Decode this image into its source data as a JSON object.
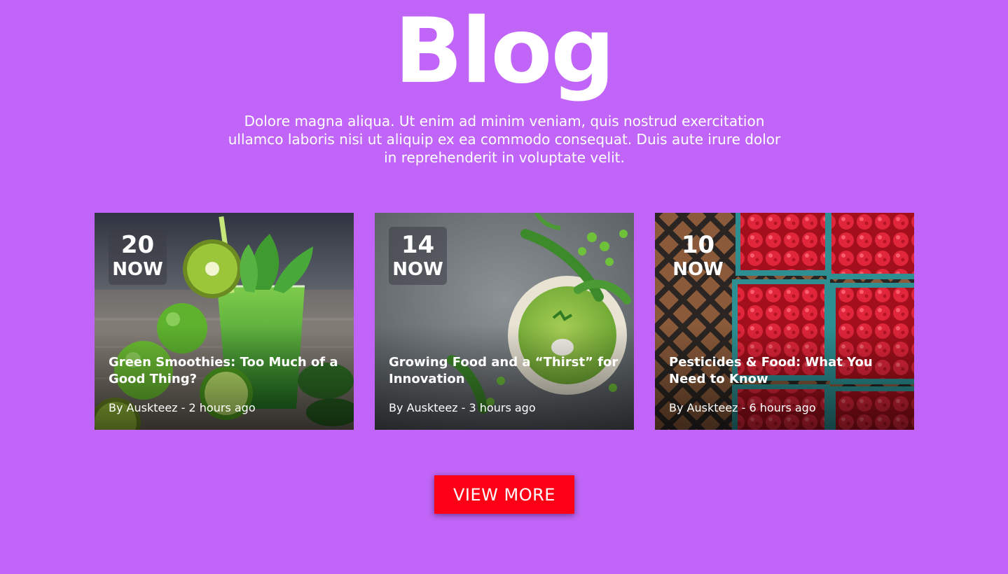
{
  "header": {
    "title": "Blog",
    "intro": "Dolore magna aliqua. Ut enim ad minim veniam, quis nostrud exercitation ullamco laboris nisi ut aliquip ex ea commodo consequat. Duis aute irure dolor in reprehenderit in voluptate velit."
  },
  "posts": [
    {
      "day": "20",
      "day_label": "NOW",
      "title": "Green Smoothies: Too Much of a Good Thing?",
      "meta": "By Auskteez - 2 hours ago",
      "image": "green-smoothie-kiwi-apple-photo"
    },
    {
      "day": "14",
      "day_label": "NOW",
      "title": "Growing Food and a “Thirst” for Innovation",
      "meta": "By Auskteez - 3 hours ago",
      "image": "pea-soup-bowl-photo"
    },
    {
      "day": "10",
      "day_label": "NOW",
      "title": "Pesticides & Food: What You Need to Know",
      "meta": "By Auskteez - 6 hours ago",
      "image": "raspberries-in-baskets-photo"
    }
  ],
  "cta": {
    "label": "VIEW MORE"
  },
  "colors": {
    "background": "#c065f7",
    "button": "#fe0016",
    "text": "#ffffff"
  }
}
